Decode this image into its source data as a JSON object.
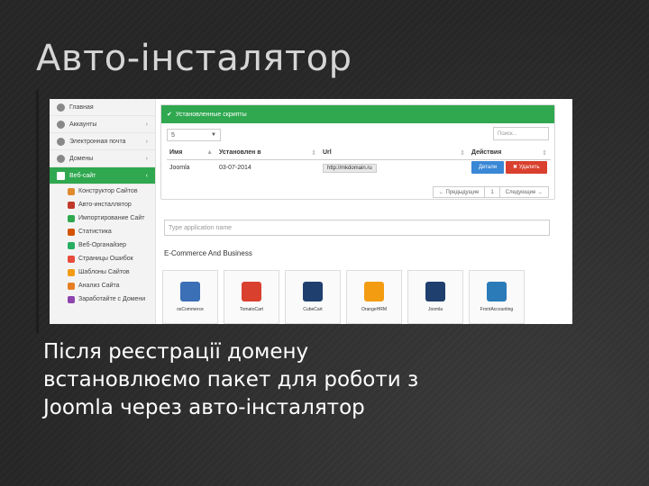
{
  "slide": {
    "title": "Авто-інсталятор",
    "caption_lines": [
      "Після реєстрації домену",
      "встановлюємо пакет для роботи з",
      "Joomla через авто-інсталятор"
    ]
  },
  "sidebar": {
    "items": [
      {
        "label": "Главная",
        "icon": "home-icon"
      },
      {
        "label": "Аккаунты",
        "icon": "user-icon"
      },
      {
        "label": "Электронная почта",
        "icon": "mail-icon"
      },
      {
        "label": "Домены",
        "icon": "globe-icon"
      },
      {
        "label": "Веб-сайт",
        "icon": "monitor-icon",
        "active": true
      }
    ],
    "subitems": [
      {
        "label": "Конструктор Сайтов",
        "color": "#e08a2e"
      },
      {
        "label": "Авто-инсталлятор",
        "color": "#c0392b"
      },
      {
        "label": "Импортирование Сайт",
        "color": "#2fa84f"
      },
      {
        "label": "Статистика",
        "color": "#d35400"
      },
      {
        "label": "Веб-Органайзер",
        "color": "#27ae60"
      },
      {
        "label": "Страницы Ошибок",
        "color": "#e74c3c"
      },
      {
        "label": "Шаблоны Сайтов",
        "color": "#f39c12"
      },
      {
        "label": "Анализ Сайта",
        "color": "#e67e22"
      },
      {
        "label": "Заработайте с Домени",
        "color": "#8e44ad"
      }
    ]
  },
  "panel": {
    "header": "Установленные скрипты",
    "page_size": "5",
    "search_placeholder": "Поиск...",
    "columns": [
      "Имя",
      "Установлен в",
      "Url",
      "Действия"
    ],
    "rows": [
      {
        "name": "Joomla",
        "installed": "03-07-2014",
        "url": "http://mkdomain.ru",
        "edit": "Детали",
        "delete": "✖ Удалить"
      }
    ],
    "pager": [
      "← Предыдущие",
      "1",
      "Следующие →"
    ]
  },
  "apps_search_placeholder": "Type application name",
  "category": "E-Commerce And Business",
  "apps": [
    {
      "name": "osCommerce",
      "color": "#3b6fb6"
    },
    {
      "name": "TomatoCart",
      "color": "#d9402e"
    },
    {
      "name": "CubeCart",
      "color": "#1f3f6e"
    },
    {
      "name": "OrangeHRM",
      "color": "#f39c12"
    },
    {
      "name": "Joomla",
      "color": "#1f3f6e"
    },
    {
      "name": "FrontAccounting",
      "color": "#2a7bb8"
    }
  ]
}
